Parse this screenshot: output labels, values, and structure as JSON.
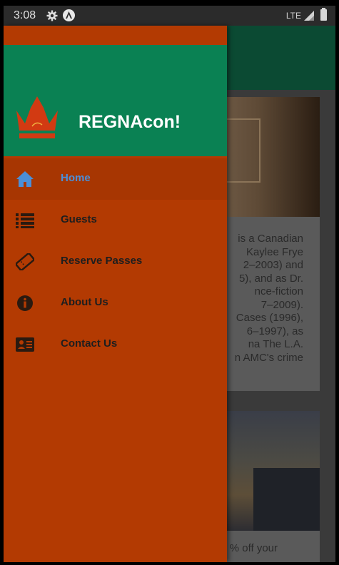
{
  "status_bar": {
    "time": "3:08",
    "network": "LTE",
    "icons": [
      "gear-icon",
      "app-icon",
      "signal-icon",
      "battery-icon"
    ]
  },
  "app": {
    "title": "REGNAcon!",
    "colors": {
      "drawer_background": "#b33a02",
      "header_background": "#0a8153",
      "active_label": "#4a8fd9",
      "logo": "#d23a12"
    }
  },
  "drawer": {
    "items": [
      {
        "label": "Home",
        "icon": "home-icon",
        "active": true
      },
      {
        "label": "Guests",
        "icon": "list-icon",
        "active": false
      },
      {
        "label": "Reserve Passes",
        "icon": "ticket-icon",
        "active": false
      },
      {
        "label": "About Us",
        "icon": "info-icon",
        "active": false
      },
      {
        "label": "Contact Us",
        "icon": "contact-card-icon",
        "active": false
      }
    ]
  },
  "background_content": {
    "card1_text": "is a Canadian\nKaylee Frye\n2–2003) and\n5), and as Dr.\nnce-fiction\n7–2009).\nCases (1996),\n6–1997), as\nna The L.A.\nn AMC's crime",
    "card2_text": "% off your"
  }
}
